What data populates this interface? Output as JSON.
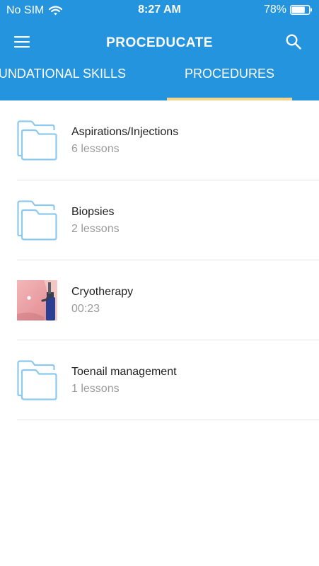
{
  "status_bar": {
    "carrier": "No SIM",
    "time": "8:27 AM",
    "battery": "78%",
    "battery_level": 0.78
  },
  "toolbar": {
    "title": "PROCEDUCATE",
    "menu_icon": "hamburger-menu-icon",
    "search_icon": "search-icon"
  },
  "tabs": [
    {
      "label": "FOUNDATIONAL SKILLS"
    },
    {
      "label": "PROCEDURES",
      "active": true
    }
  ],
  "items": [
    {
      "title": "Aspirations/Injections",
      "subtitle": "6 lessons",
      "icon": "folder-icon"
    },
    {
      "title": "Biopsies",
      "subtitle": "2 lessons",
      "icon": "folder-icon"
    },
    {
      "title": "Cryotherapy",
      "subtitle": "00:23",
      "icon": "video-thumbnail"
    },
    {
      "title": "Toenail management",
      "subtitle": "1 lessons",
      "icon": "folder-icon"
    }
  ],
  "colors": {
    "header": "#2494de",
    "tab_indicator": "#f3d48c",
    "folder_stroke": "#8cc9ee",
    "subtitle": "#9b9b9b",
    "divider": "#e5e5e5"
  }
}
